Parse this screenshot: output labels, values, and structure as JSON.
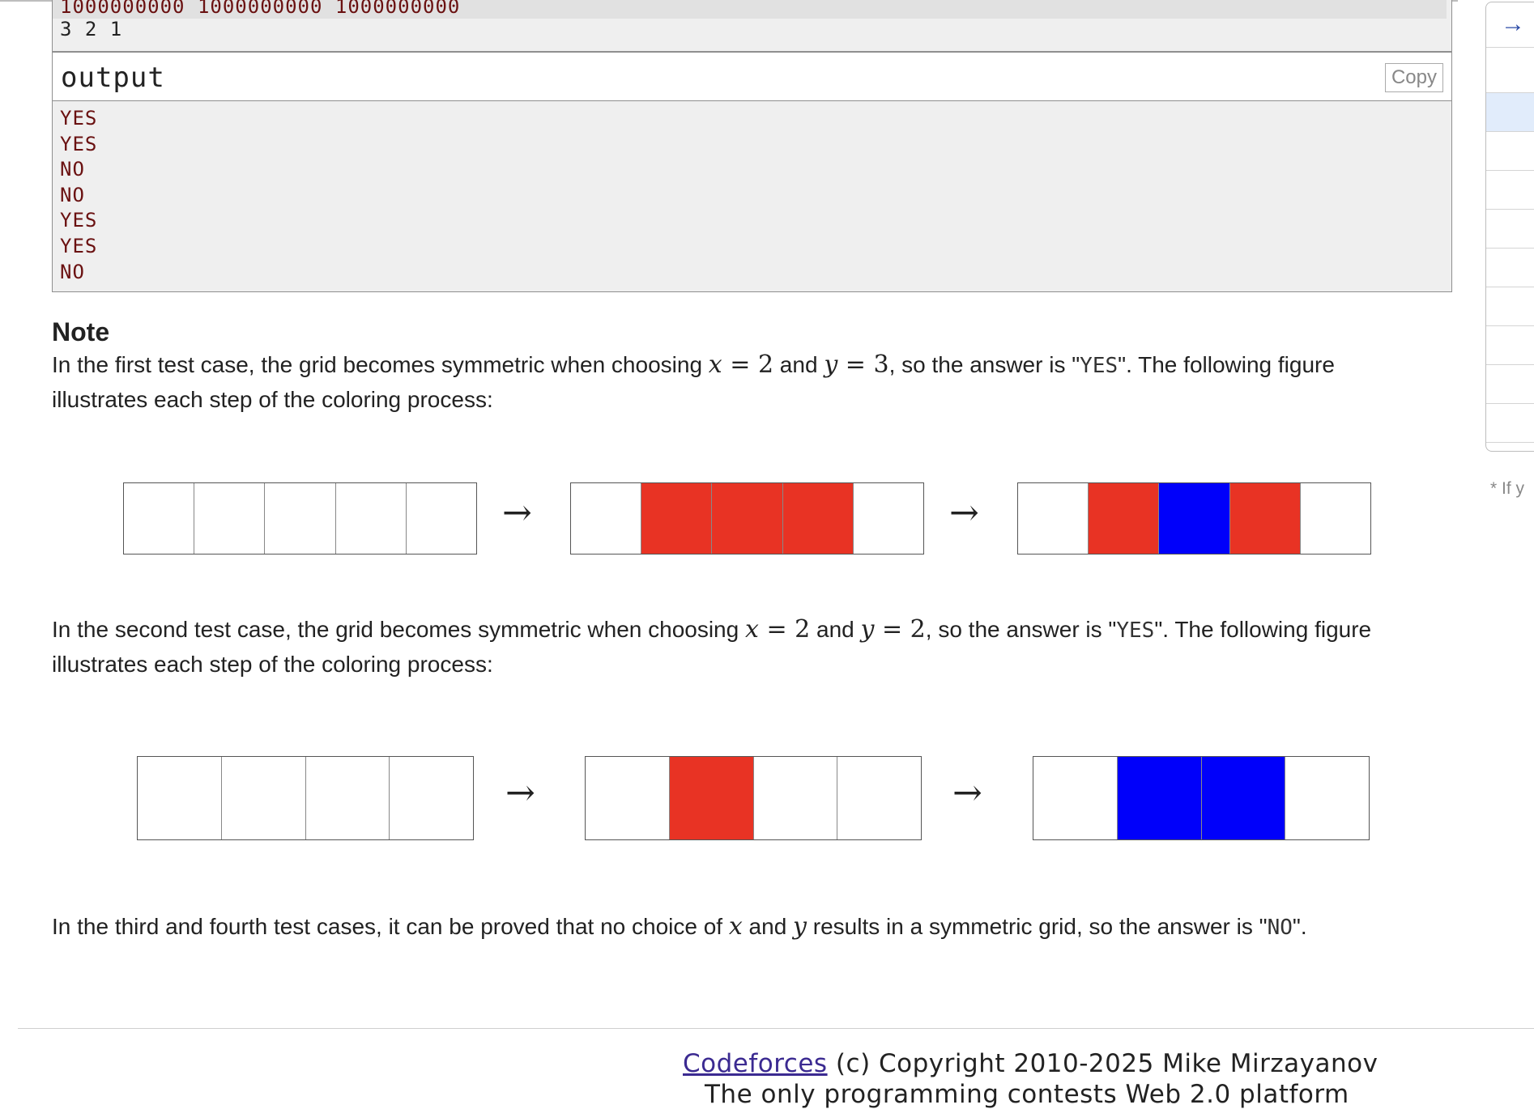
{
  "input": {
    "lines": [
      "1000000000 1000000000 1000000000",
      "3 2 1"
    ]
  },
  "output": {
    "title": "output",
    "copy_label": "Copy",
    "lines": [
      "YES",
      "YES",
      "NO",
      "NO",
      "YES",
      "YES",
      "NO"
    ]
  },
  "note": {
    "title": "Note",
    "para1": {
      "t1": "In the first test case, the grid becomes symmetric when choosing ",
      "x": "x",
      "eq1": " = ",
      "xv": "2",
      "and": " and ",
      "y": "y",
      "eq2": " = ",
      "yv": "3",
      "t2": ", so the answer is \"",
      "code": "YES",
      "t3": "\". The following figure illustrates each step of the coloring process:"
    },
    "para2": {
      "t1": "In the second test case, the grid becomes symmetric when choosing ",
      "x": "x",
      "eq1": " = ",
      "xv": "2",
      "and": " and ",
      "y": "y",
      "eq2": " = ",
      "yv": "2",
      "t2": ", so the answer is \"",
      "code": "YES",
      "t3": "\". The following figure illustrates each step of the coloring process:"
    },
    "para3": {
      "t1": "In the third and fourth test cases, it can be proved that no choice of ",
      "x": "x",
      "and": " and ",
      "y": "y",
      "t2": " results in a symmetric grid, so the answer is \"",
      "code": "NO",
      "t3": "\"."
    },
    "figure1": {
      "steps": [
        [
          "white",
          "white",
          "white",
          "white",
          "white"
        ],
        [
          "white",
          "red",
          "red",
          "red",
          "white"
        ],
        [
          "white",
          "red",
          "blue",
          "red",
          "white"
        ]
      ]
    },
    "figure2": {
      "steps": [
        [
          "white",
          "white",
          "white",
          "white"
        ],
        [
          "white",
          "red",
          "white",
          "white"
        ],
        [
          "white",
          "blue",
          "blue",
          "white"
        ]
      ]
    },
    "arrow_glyph": "→"
  },
  "colors": {
    "red": "#e83324",
    "blue": "#0000fa",
    "white": "#ffffff"
  },
  "footer": {
    "link": "Codeforces",
    "copyright": " (c) Copyright 2010-2025 Mike Mirzayanov",
    "tagline": "The only programming contests Web 2.0 platform"
  },
  "sidebar": {
    "arrow_glyph": "→",
    "note_text": "* If y"
  }
}
